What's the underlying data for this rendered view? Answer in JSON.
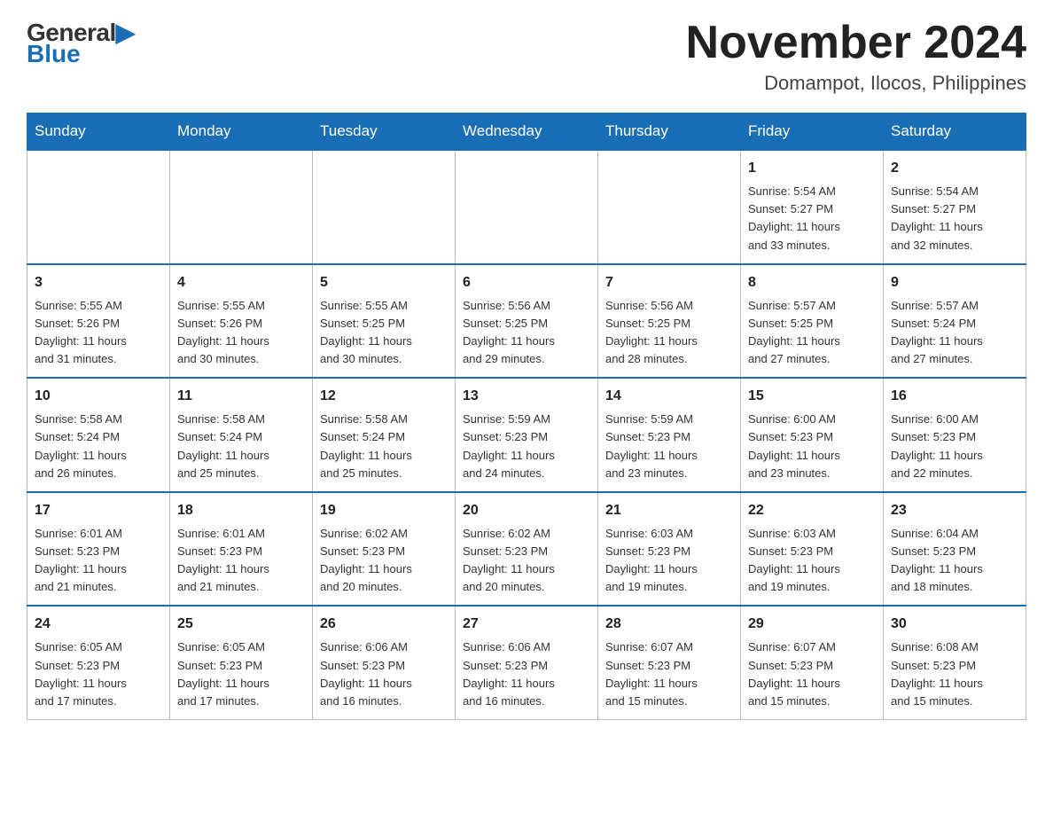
{
  "logo": {
    "general": "General",
    "blue": "Blue",
    "aria": "GeneralBlue logo"
  },
  "header": {
    "month_title": "November 2024",
    "location": "Domampot, Ilocos, Philippines"
  },
  "days_of_week": [
    "Sunday",
    "Monday",
    "Tuesday",
    "Wednesday",
    "Thursday",
    "Friday",
    "Saturday"
  ],
  "weeks": [
    {
      "days": [
        {
          "number": "",
          "info": ""
        },
        {
          "number": "",
          "info": ""
        },
        {
          "number": "",
          "info": ""
        },
        {
          "number": "",
          "info": ""
        },
        {
          "number": "",
          "info": ""
        },
        {
          "number": "1",
          "info": "Sunrise: 5:54 AM\nSunset: 5:27 PM\nDaylight: 11 hours\nand 33 minutes."
        },
        {
          "number": "2",
          "info": "Sunrise: 5:54 AM\nSunset: 5:27 PM\nDaylight: 11 hours\nand 32 minutes."
        }
      ]
    },
    {
      "days": [
        {
          "number": "3",
          "info": "Sunrise: 5:55 AM\nSunset: 5:26 PM\nDaylight: 11 hours\nand 31 minutes."
        },
        {
          "number": "4",
          "info": "Sunrise: 5:55 AM\nSunset: 5:26 PM\nDaylight: 11 hours\nand 30 minutes."
        },
        {
          "number": "5",
          "info": "Sunrise: 5:55 AM\nSunset: 5:25 PM\nDaylight: 11 hours\nand 30 minutes."
        },
        {
          "number": "6",
          "info": "Sunrise: 5:56 AM\nSunset: 5:25 PM\nDaylight: 11 hours\nand 29 minutes."
        },
        {
          "number": "7",
          "info": "Sunrise: 5:56 AM\nSunset: 5:25 PM\nDaylight: 11 hours\nand 28 minutes."
        },
        {
          "number": "8",
          "info": "Sunrise: 5:57 AM\nSunset: 5:25 PM\nDaylight: 11 hours\nand 27 minutes."
        },
        {
          "number": "9",
          "info": "Sunrise: 5:57 AM\nSunset: 5:24 PM\nDaylight: 11 hours\nand 27 minutes."
        }
      ]
    },
    {
      "days": [
        {
          "number": "10",
          "info": "Sunrise: 5:58 AM\nSunset: 5:24 PM\nDaylight: 11 hours\nand 26 minutes."
        },
        {
          "number": "11",
          "info": "Sunrise: 5:58 AM\nSunset: 5:24 PM\nDaylight: 11 hours\nand 25 minutes."
        },
        {
          "number": "12",
          "info": "Sunrise: 5:58 AM\nSunset: 5:24 PM\nDaylight: 11 hours\nand 25 minutes."
        },
        {
          "number": "13",
          "info": "Sunrise: 5:59 AM\nSunset: 5:23 PM\nDaylight: 11 hours\nand 24 minutes."
        },
        {
          "number": "14",
          "info": "Sunrise: 5:59 AM\nSunset: 5:23 PM\nDaylight: 11 hours\nand 23 minutes."
        },
        {
          "number": "15",
          "info": "Sunrise: 6:00 AM\nSunset: 5:23 PM\nDaylight: 11 hours\nand 23 minutes."
        },
        {
          "number": "16",
          "info": "Sunrise: 6:00 AM\nSunset: 5:23 PM\nDaylight: 11 hours\nand 22 minutes."
        }
      ]
    },
    {
      "days": [
        {
          "number": "17",
          "info": "Sunrise: 6:01 AM\nSunset: 5:23 PM\nDaylight: 11 hours\nand 21 minutes."
        },
        {
          "number": "18",
          "info": "Sunrise: 6:01 AM\nSunset: 5:23 PM\nDaylight: 11 hours\nand 21 minutes."
        },
        {
          "number": "19",
          "info": "Sunrise: 6:02 AM\nSunset: 5:23 PM\nDaylight: 11 hours\nand 20 minutes."
        },
        {
          "number": "20",
          "info": "Sunrise: 6:02 AM\nSunset: 5:23 PM\nDaylight: 11 hours\nand 20 minutes."
        },
        {
          "number": "21",
          "info": "Sunrise: 6:03 AM\nSunset: 5:23 PM\nDaylight: 11 hours\nand 19 minutes."
        },
        {
          "number": "22",
          "info": "Sunrise: 6:03 AM\nSunset: 5:23 PM\nDaylight: 11 hours\nand 19 minutes."
        },
        {
          "number": "23",
          "info": "Sunrise: 6:04 AM\nSunset: 5:23 PM\nDaylight: 11 hours\nand 18 minutes."
        }
      ]
    },
    {
      "days": [
        {
          "number": "24",
          "info": "Sunrise: 6:05 AM\nSunset: 5:23 PM\nDaylight: 11 hours\nand 17 minutes."
        },
        {
          "number": "25",
          "info": "Sunrise: 6:05 AM\nSunset: 5:23 PM\nDaylight: 11 hours\nand 17 minutes."
        },
        {
          "number": "26",
          "info": "Sunrise: 6:06 AM\nSunset: 5:23 PM\nDaylight: 11 hours\nand 16 minutes."
        },
        {
          "number": "27",
          "info": "Sunrise: 6:06 AM\nSunset: 5:23 PM\nDaylight: 11 hours\nand 16 minutes."
        },
        {
          "number": "28",
          "info": "Sunrise: 6:07 AM\nSunset: 5:23 PM\nDaylight: 11 hours\nand 15 minutes."
        },
        {
          "number": "29",
          "info": "Sunrise: 6:07 AM\nSunset: 5:23 PM\nDaylight: 11 hours\nand 15 minutes."
        },
        {
          "number": "30",
          "info": "Sunrise: 6:08 AM\nSunset: 5:23 PM\nDaylight: 11 hours\nand 15 minutes."
        }
      ]
    }
  ]
}
